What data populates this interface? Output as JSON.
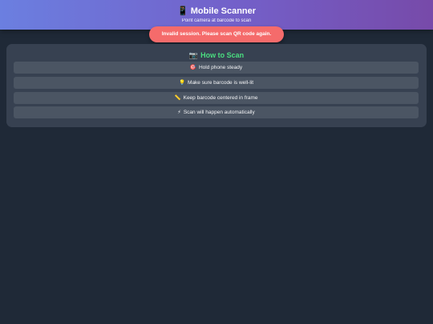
{
  "header": {
    "icon": "📱",
    "icon_name": "phone-icon",
    "title": "Mobile Scanner",
    "subtitle": "Point camera at barcode to scan"
  },
  "error": {
    "message": "Invalid session. Please scan QR code again."
  },
  "how_to": {
    "icon": "📷",
    "icon_name": "camera-icon",
    "title": "How to Scan",
    "steps": [
      {
        "icon": "🎯",
        "icon_name": "target-icon",
        "text": "Hold phone steady"
      },
      {
        "icon": "💡",
        "icon_name": "lightbulb-icon",
        "text": "Make sure barcode is well-lit"
      },
      {
        "icon": "📏",
        "icon_name": "ruler-icon",
        "text": "Keep barcode centered in frame"
      },
      {
        "icon": "⚡",
        "icon_name": "lightning-icon",
        "text": "Scan will happen automatically"
      }
    ]
  },
  "colors": {
    "header_gradient_start": "#6b7fe0",
    "header_gradient_end": "#774aa9",
    "error_bg": "#f56b6b",
    "page_bg": "#1f2937",
    "card_bg": "#374151",
    "step_bg": "#4b5563",
    "accent_green": "#4ade80"
  }
}
